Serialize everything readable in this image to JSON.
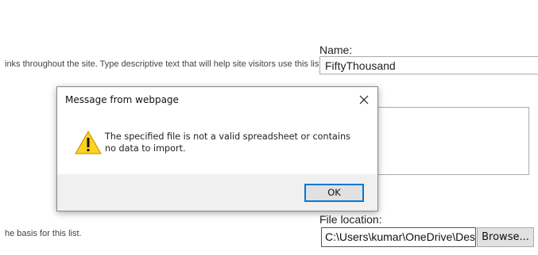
{
  "background_page": {
    "name_label": "Name:",
    "name_value": "FiftyThousand",
    "name_description": "inks throughout the site. Type descriptive text that will help site visitors use this list.",
    "file_description": "he basis for this list.",
    "file_location_label": "File location:",
    "file_path_value": "C:\\Users\\kumar\\OneDrive\\Deskto",
    "browse_label": "Browse..."
  },
  "dialog": {
    "title": "Message from webpage",
    "message": "The specified file is not a valid spreadsheet or contains no data to import.",
    "ok_label": "OK",
    "icon": "warning-icon",
    "close_icon": "close-icon"
  },
  "colors": {
    "ok_focus_border": "#0078d7",
    "warning_fill": "#ffd21e",
    "dialog_footer_bg": "#f0f0f0"
  }
}
